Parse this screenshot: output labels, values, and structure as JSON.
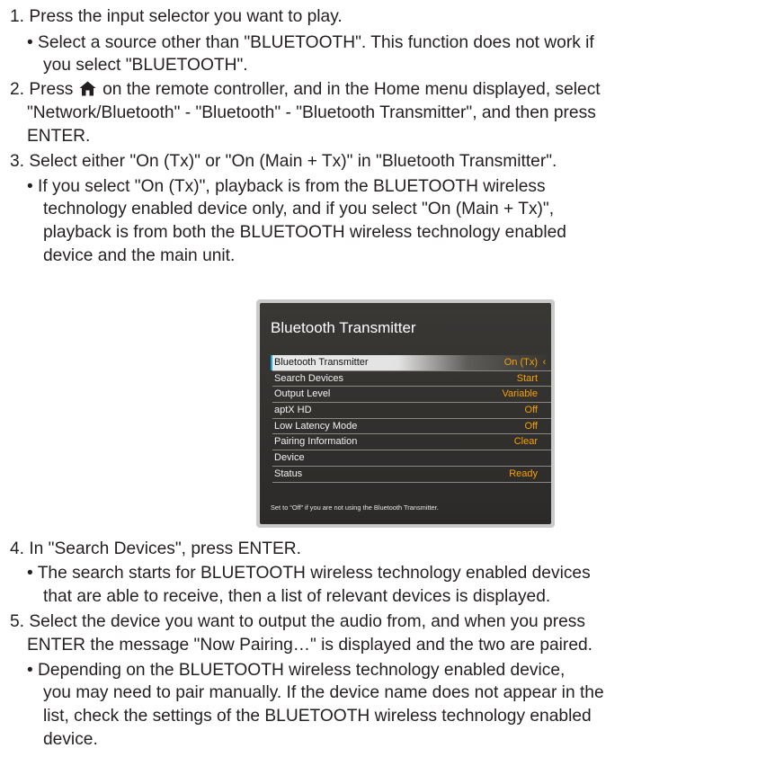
{
  "steps": {
    "s1": "1. Press the input selector you want to play.",
    "s1_b1_l1": "• Select a source other than \"BLUETOOTH\". This function does not work if",
    "s1_b1_l2": "you select \"BLUETOOTH\".",
    "s2_l1a": "2. Press",
    "s2_l1b": "on the remote controller, and in the Home menu displayed, select",
    "s2_l2": "\"Network/Bluetooth\" - \"Bluetooth\" - \"Bluetooth Transmitter\", and then press",
    "s2_l3": "ENTER.",
    "s3": "3. Select either \"On (Tx)\" or \"On (Main + Tx)\" in \"Bluetooth Transmitter\".",
    "s3_b1_l1": "• If you select \"On (Tx)\", playback is from the BLUETOOTH wireless",
    "s3_b1_l2": "technology enabled device only, and if you select \"On (Main + Tx)\",",
    "s3_b1_l3": "playback is from both the BLUETOOTH wireless technology enabled",
    "s3_b1_l4": "device and the main unit.",
    "s4": "4. In \"Search Devices\", press ENTER.",
    "s4_b1_l1": "• The search starts for BLUETOOTH wireless technology enabled devices",
    "s4_b1_l2": "that are able to receive, then a list of relevant devices is displayed.",
    "s5_l1": "5. Select the device you want to output the audio from, and when you press",
    "s5_l2": "ENTER the message \"Now Pairing…\" is displayed and the two are paired.",
    "s5_b1_l1": "• Depending on the BLUETOOTH wireless technology enabled device,",
    "s5_b1_l2": "you may need to pair manually. If the device name does not appear in the",
    "s5_b1_l3": "list, check the settings of the BLUETOOTH wireless technology enabled",
    "s5_b1_l4": "device."
  },
  "screen": {
    "title": "Bluetooth Transmitter",
    "rows": [
      {
        "label": "Bluetooth Transmitter",
        "value": "On (Tx)",
        "arrows": "‹ ›"
      },
      {
        "label": "Search Devices",
        "value": "Start"
      },
      {
        "label": "Output Level",
        "value": "Variable"
      },
      {
        "label": "aptX HD",
        "value": "Off"
      },
      {
        "label": "Low Latency Mode",
        "value": "Off"
      },
      {
        "label": "Pairing Information",
        "value": "Clear"
      },
      {
        "label": "Device",
        "value": ""
      },
      {
        "label": "Status",
        "value": "Ready"
      }
    ],
    "footnote": "Set to “Off” if you are not using the Bluetooth Transmitter."
  },
  "icons": {
    "home": "home-icon"
  },
  "colors": {
    "accent_value": "#f6a100",
    "selection_bar": "#1da7e0",
    "text": "#231f20"
  }
}
